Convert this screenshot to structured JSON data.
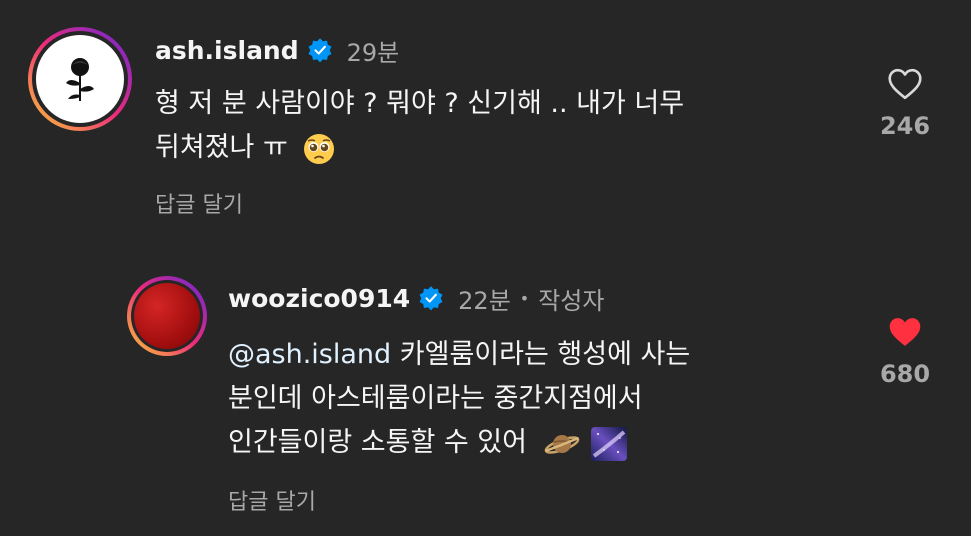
{
  "comments": [
    {
      "username": "ash.island",
      "time": "29분",
      "lines": [
        "형 저 분 사람이야 ? 뭐야 ? 신기해 .. 내가 너무",
        "뒤쳐졌나 ㅠ"
      ],
      "emoji": "pleading-face",
      "reply_label": "답글 달기",
      "likes": "246",
      "liked": false
    },
    {
      "username": "woozico0914",
      "time": "22분",
      "dot": "•",
      "author_tag": "작성자",
      "mention": "@ash.island",
      "line1_rest": " 카엘룸이라는 행성에 사는",
      "line2": "분인데 아스테룸이라는 중간지점에서",
      "line3": "인간들이랑 소통할 수 있어",
      "emojis": [
        "ringed-planet",
        "milky-way"
      ],
      "reply_label": "답글 달기",
      "likes": "680",
      "liked": true
    }
  ],
  "colors": {
    "background": "#262626",
    "verified": "#0095f6",
    "heart_liked": "#ff3040",
    "secondary_text": "#a8a8a8"
  }
}
